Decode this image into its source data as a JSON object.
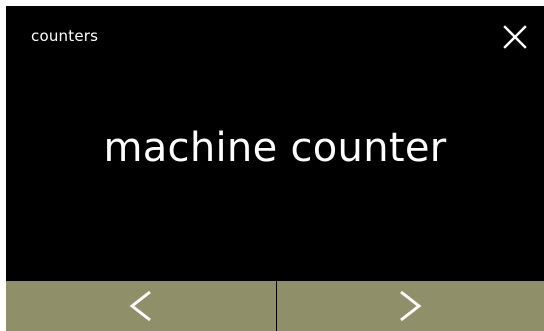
{
  "header": {
    "title": "counters",
    "close_icon": "close-icon"
  },
  "main": {
    "title": "machine counter"
  },
  "nav": {
    "prev_icon": "chevron-left-icon",
    "next_icon": "chevron-right-icon"
  },
  "colors": {
    "screen_background": "#000000",
    "text": "#ffffff",
    "nav_bar": "#8f8f6a"
  }
}
